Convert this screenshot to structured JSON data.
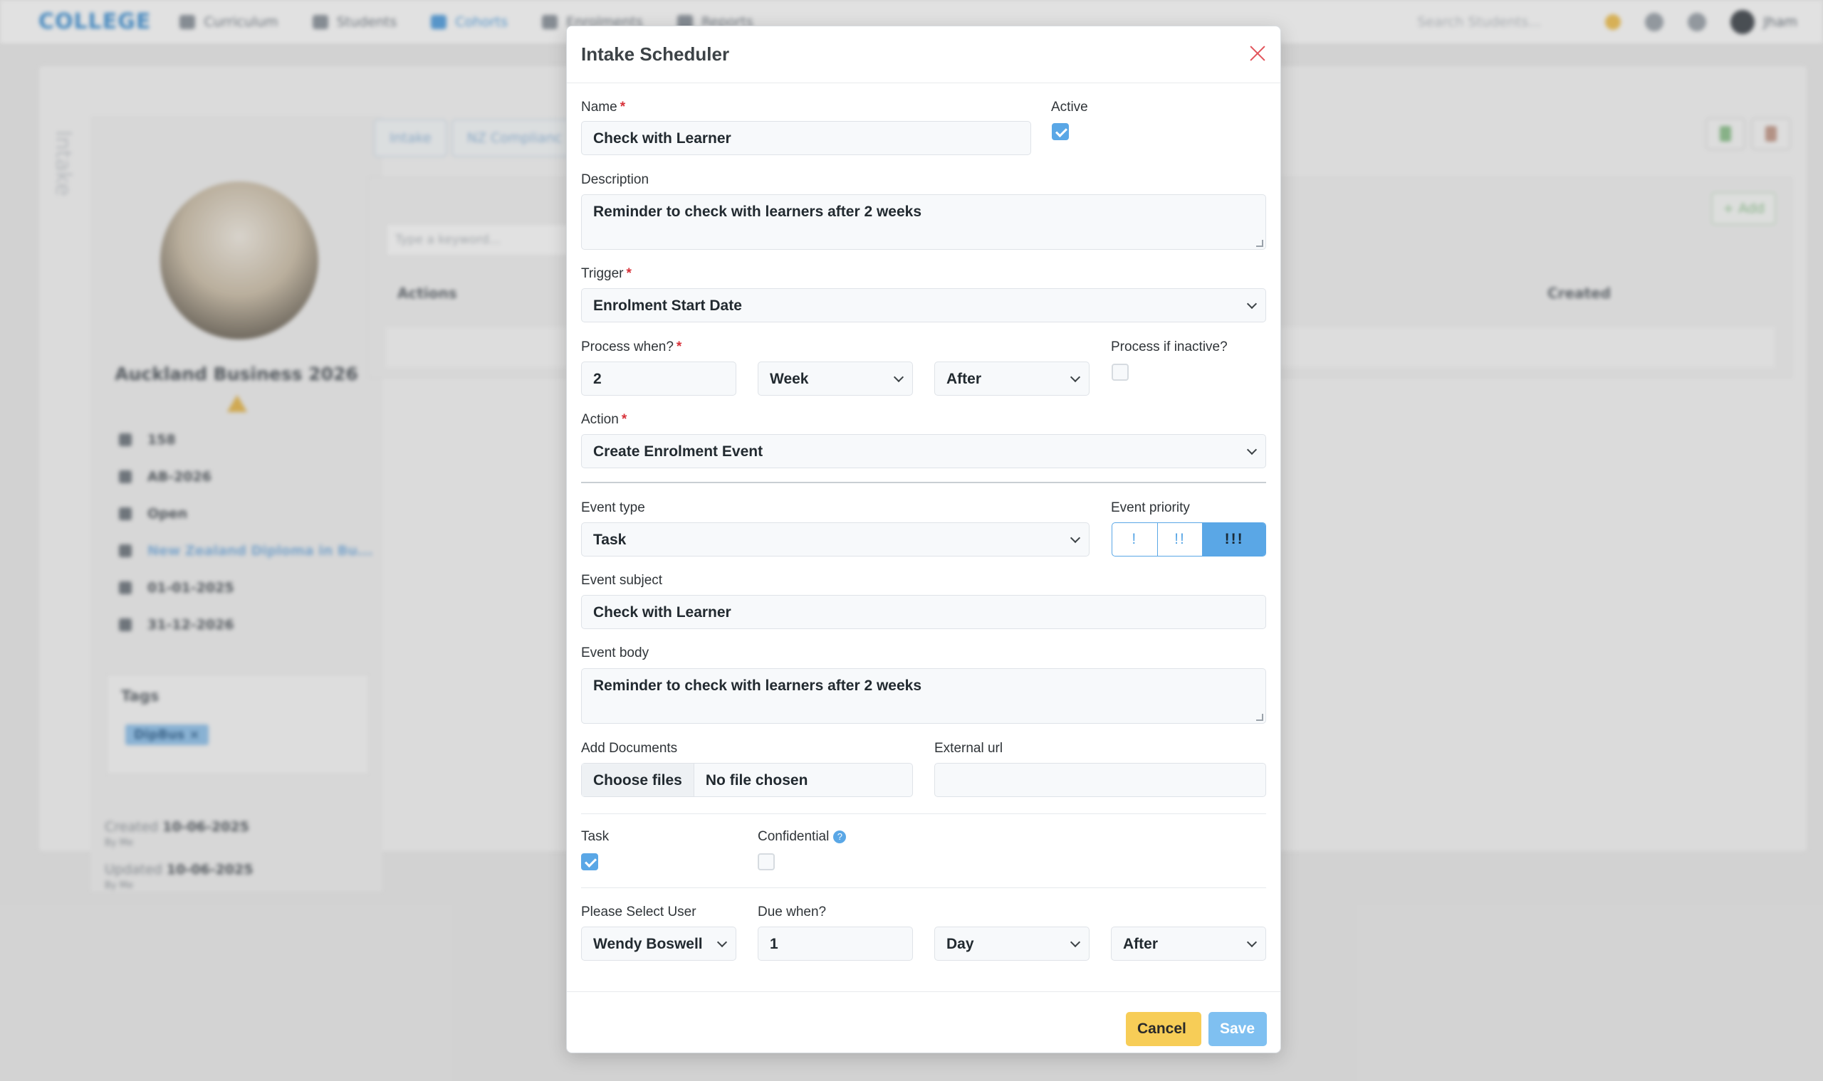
{
  "background": {
    "brand": "COLLEGE",
    "nav": [
      {
        "label": "Curriculum"
      },
      {
        "label": "Students"
      },
      {
        "label": "Cohorts"
      },
      {
        "label": "Enrolments"
      },
      {
        "label": "Reports"
      }
    ],
    "search_placeholder": "Search Students...",
    "user": "Jham",
    "side_label": "Intake",
    "profile": {
      "title": "Auckland Business 2026",
      "id": "158",
      "code": "AB-2026",
      "status": "Open",
      "qualification": "New Zealand Diploma in Bu...",
      "start": "01-01-2025",
      "end": "31-12-2026",
      "tags_title": "Tags",
      "tag": "DipBus",
      "created_label": "Created",
      "created_date": "10-06-2025",
      "created_by": "By Me",
      "updated_label": "Updated",
      "updated_date": "10-06-2025",
      "updated_by": "By Me"
    },
    "tabs": [
      "Intake",
      "NZ Complianc"
    ],
    "keyword_placeholder": "Type a keyword...",
    "col_actions": "Actions",
    "col_created": "Created",
    "add_label": "+ Add"
  },
  "modal": {
    "title": "Intake Scheduler",
    "name_label": "Name",
    "name_value": "Check with Learner",
    "active_label": "Active",
    "active_checked": true,
    "description_label": "Description",
    "description_value": "Reminder to check with learners after 2 weeks",
    "trigger_label": "Trigger",
    "trigger_value": "Enrolment Start Date",
    "process_when_label": "Process when?",
    "process_amount": "2",
    "process_unit": "Week",
    "process_direction": "After",
    "process_inactive_label": "Process if inactive?",
    "process_inactive_checked": false,
    "action_label": "Action",
    "action_value": "Create Enrolment Event",
    "event_type_label": "Event type",
    "event_type_value": "Task",
    "event_priority_label": "Event priority",
    "priority_options": [
      "!",
      "!!",
      "!!!"
    ],
    "priority_selected": "!!!",
    "event_subject_label": "Event subject",
    "event_subject_value": "Check with Learner",
    "event_body_label": "Event body",
    "event_body_value": "Reminder to check with learners after 2 weeks",
    "add_documents_label": "Add Documents",
    "choose_files": "Choose files",
    "no_file": "No file chosen",
    "external_url_label": "External url",
    "external_url_value": "",
    "task_label": "Task",
    "task_checked": true,
    "confidential_label": "Confidential",
    "confidential_checked": false,
    "user_label": "Please Select User",
    "user_value": "Wendy Boswell",
    "due_when_label": "Due when?",
    "due_amount": "1",
    "due_unit": "Day",
    "due_direction": "After",
    "cancel_label": "Cancel",
    "save_label": "Save"
  },
  "colors": {
    "accent": "#5aa7e6",
    "cancel": "#f7cd57",
    "save": "#7fc0f1",
    "required": "#d8323a",
    "close": "#e2545b"
  }
}
